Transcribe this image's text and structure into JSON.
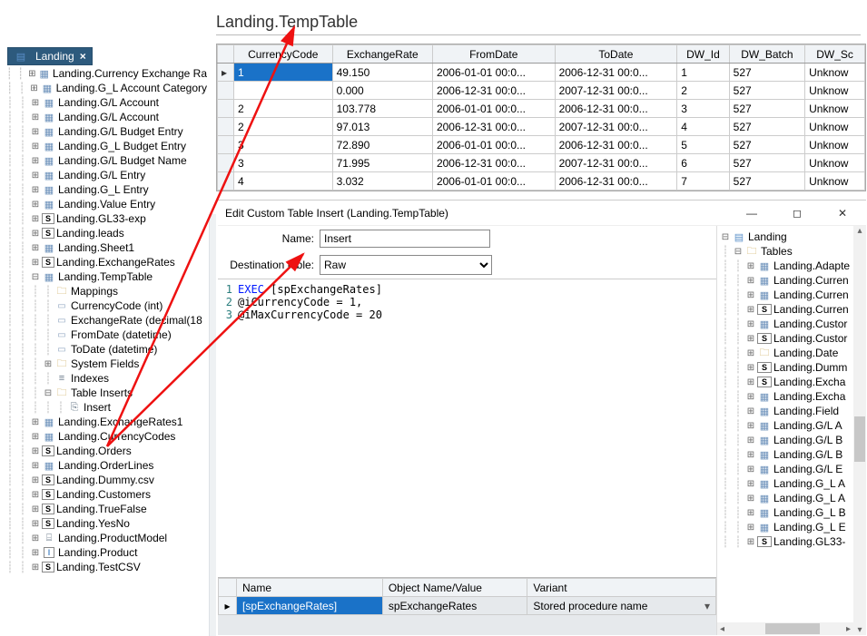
{
  "sidebar": {
    "tab_label": "Landing",
    "items": [
      {
        "label": "Landing.Currency Exchange Ra",
        "icon": "tbl",
        "tw": "plus",
        "indent": 1
      },
      {
        "label": "Landing.G_L Account Category",
        "icon": "tbl",
        "tw": "plus",
        "indent": 1
      },
      {
        "label": "Landing.G/L Account",
        "icon": "tbl",
        "tw": "plus",
        "indent": 1
      },
      {
        "label": "Landing.G/L Account",
        "icon": "tbl",
        "tw": "plus",
        "indent": 1
      },
      {
        "label": "Landing.G/L Budget Entry",
        "icon": "tbl",
        "tw": "plus",
        "indent": 1
      },
      {
        "label": "Landing.G_L Budget Entry",
        "icon": "tbl",
        "tw": "plus",
        "indent": 1
      },
      {
        "label": "Landing.G/L Budget Name",
        "icon": "tbl",
        "tw": "plus",
        "indent": 1
      },
      {
        "label": "Landing.G/L Entry",
        "icon": "tbl",
        "tw": "plus",
        "indent": 1
      },
      {
        "label": "Landing.G_L Entry",
        "icon": "tbl",
        "tw": "plus",
        "indent": 1
      },
      {
        "label": "Landing.Value Entry",
        "icon": "tbl",
        "tw": "plus",
        "indent": 1
      },
      {
        "label": "Landing.GL33-exp",
        "icon": "s",
        "tw": "plus",
        "indent": 1
      },
      {
        "label": "Landing.leads",
        "icon": "s",
        "tw": "plus",
        "indent": 1
      },
      {
        "label": "Landing.Sheet1",
        "icon": "tbl",
        "tw": "plus",
        "indent": 1
      },
      {
        "label": "Landing.ExchangeRates",
        "icon": "s",
        "tw": "plus",
        "indent": 1
      },
      {
        "label": "Landing.TempTable",
        "icon": "tbl",
        "tw": "minus",
        "indent": 1
      },
      {
        "label": "Mappings",
        "icon": "fld",
        "tw": "",
        "indent": 2
      },
      {
        "label": "CurrencyCode (int)",
        "icon": "col",
        "tw": "",
        "indent": 2
      },
      {
        "label": "ExchangeRate (decimal(18",
        "icon": "col",
        "tw": "",
        "indent": 2
      },
      {
        "label": "FromDate (datetime)",
        "icon": "col",
        "tw": "",
        "indent": 2
      },
      {
        "label": "ToDate (datetime)",
        "icon": "col",
        "tw": "",
        "indent": 2
      },
      {
        "label": "System Fields",
        "icon": "fld",
        "tw": "plus",
        "indent": 2
      },
      {
        "label": "Indexes",
        "icon": "idx",
        "tw": "",
        "indent": 2
      },
      {
        "label": "Table Inserts",
        "icon": "fld",
        "tw": "minus",
        "indent": 2
      },
      {
        "label": "Insert",
        "icon": "ins",
        "tw": "",
        "indent": 3
      },
      {
        "label": "Landing.ExchangeRates1",
        "icon": "tbl",
        "tw": "plus",
        "indent": 1
      },
      {
        "label": "Landing.CurrencyCodes",
        "icon": "tbl",
        "tw": "plus",
        "indent": 1
      },
      {
        "label": "Landing.Orders",
        "icon": "s",
        "tw": "plus",
        "indent": 1
      },
      {
        "label": "Landing.OrderLines",
        "icon": "tbl",
        "tw": "plus",
        "indent": 1
      },
      {
        "label": "Landing.Dummy.csv",
        "icon": "s",
        "tw": "plus",
        "indent": 1
      },
      {
        "label": "Landing.Customers",
        "icon": "s",
        "tw": "plus",
        "indent": 1
      },
      {
        "label": "Landing.TrueFalse",
        "icon": "s",
        "tw": "plus",
        "indent": 1
      },
      {
        "label": "Landing.YesNo",
        "icon": "s",
        "tw": "plus",
        "indent": 1
      },
      {
        "label": "Landing.ProductModel",
        "icon": "prod",
        "tw": "plus",
        "indent": 1
      },
      {
        "label": "Landing.Product",
        "icon": "il",
        "tw": "plus",
        "indent": 1
      },
      {
        "label": "Landing.TestCSV",
        "icon": "s",
        "tw": "plus",
        "indent": 1
      }
    ]
  },
  "main_table": {
    "title": "Landing.TempTable",
    "columns": [
      "CurrencyCode",
      "ExchangeRate",
      "FromDate",
      "ToDate",
      "DW_Id",
      "DW_Batch",
      "DW_Sc"
    ],
    "rows": [
      [
        "1",
        "49.150",
        "2006-01-01 00:0...",
        "2006-12-31 00:0...",
        "1",
        "527",
        "Unknow"
      ],
      [
        "",
        "0.000",
        "2006-12-31 00:0...",
        "2007-12-31 00:0...",
        "2",
        "527",
        "Unknow"
      ],
      [
        "2",
        "103.778",
        "2006-01-01 00:0...",
        "2006-12-31 00:0...",
        "3",
        "527",
        "Unknow"
      ],
      [
        "2",
        "97.013",
        "2006-12-31 00:0...",
        "2007-12-31 00:0...",
        "4",
        "527",
        "Unknow"
      ],
      [
        "3",
        "72.890",
        "2006-01-01 00:0...",
        "2006-12-31 00:0...",
        "5",
        "527",
        "Unknow"
      ],
      [
        "3",
        "71.995",
        "2006-12-31 00:0...",
        "2007-12-31 00:0...",
        "6",
        "527",
        "Unknow"
      ],
      [
        "4",
        "3.032",
        "2006-01-01 00:0...",
        "2006-12-31 00:0...",
        "7",
        "527",
        "Unknow"
      ]
    ]
  },
  "dialog": {
    "title": "Edit Custom Table Insert (Landing.TempTable)",
    "name_label": "Name:",
    "name_value": "Insert",
    "dest_label": "Destination table:",
    "dest_value": "Raw",
    "code_lines": [
      {
        "n": "1",
        "pre": "",
        "kw": "EXEC",
        "post": " [spExchangeRates]"
      },
      {
        "n": "2",
        "pre": "@iCurrencyCode = 1,",
        "kw": "",
        "post": ""
      },
      {
        "n": "3",
        "pre": "@iMaxCurrencyCode = 20",
        "kw": "",
        "post": ""
      }
    ],
    "list": {
      "cols": [
        "Name",
        "Object Name/Value",
        "Variant"
      ],
      "row": [
        "[spExchangeRates]",
        "spExchangeRates",
        "Stored procedure name"
      ]
    },
    "right_tree": {
      "root": "Landing",
      "group": "Tables",
      "items": [
        {
          "label": "Landing.Adapte",
          "icon": "tbl"
        },
        {
          "label": "Landing.Curren",
          "icon": "tbl"
        },
        {
          "label": "Landing.Curren",
          "icon": "tbl"
        },
        {
          "label": "Landing.Curren",
          "icon": "s"
        },
        {
          "label": "Landing.Custor",
          "icon": "tbl"
        },
        {
          "label": "Landing.Custor",
          "icon": "s"
        },
        {
          "label": "Landing.Date",
          "icon": "fld"
        },
        {
          "label": "Landing.Dumm",
          "icon": "s"
        },
        {
          "label": "Landing.Excha",
          "icon": "s"
        },
        {
          "label": "Landing.Excha",
          "icon": "tbl"
        },
        {
          "label": "Landing.Field",
          "icon": "tbl"
        },
        {
          "label": "Landing.G/L A",
          "icon": "tbl"
        },
        {
          "label": "Landing.G/L B",
          "icon": "tbl"
        },
        {
          "label": "Landing.G/L B",
          "icon": "tbl"
        },
        {
          "label": "Landing.G/L E",
          "icon": "tbl"
        },
        {
          "label": "Landing.G_L A",
          "icon": "tbl"
        },
        {
          "label": "Landing.G_L A",
          "icon": "tbl"
        },
        {
          "label": "Landing.G_L B",
          "icon": "tbl"
        },
        {
          "label": "Landing.G_L E",
          "icon": "tbl"
        },
        {
          "label": "Landing.GL33-",
          "icon": "s"
        }
      ]
    }
  }
}
